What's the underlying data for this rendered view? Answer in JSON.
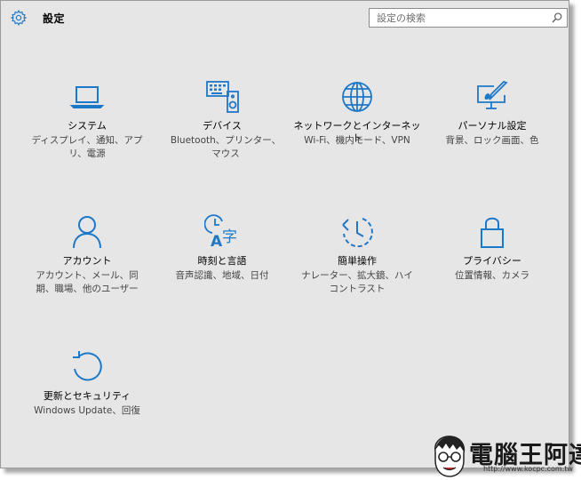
{
  "app": {
    "title": "設定"
  },
  "search": {
    "placeholder": "設定の検索"
  },
  "colors": {
    "accent": "#1e78c8",
    "background": "#e6e6e6"
  },
  "tiles": [
    {
      "id": "system",
      "icon": "laptop-icon",
      "name": "システム",
      "desc": "ディスプレイ、通知、アプリ、電源"
    },
    {
      "id": "devices",
      "icon": "devices-icon",
      "name": "デバイス",
      "desc": "Bluetooth、プリンター、マウス"
    },
    {
      "id": "network",
      "icon": "globe-icon",
      "name": "ネットワークとインターネット",
      "desc": "Wi-Fi、機内モード、VPN"
    },
    {
      "id": "personalization",
      "icon": "paint-icon",
      "name": "パーソナル設定",
      "desc": "背景、ロック画面、色"
    },
    {
      "id": "accounts",
      "icon": "person-icon",
      "name": "アカウント",
      "desc": "アカウント、メール、同期、職場、他のユーザー"
    },
    {
      "id": "time",
      "icon": "time-language-icon",
      "name": "時刻と言語",
      "desc": "音声認識、地域、日付"
    },
    {
      "id": "ease",
      "icon": "ease-of-access-icon",
      "name": "簡単操作",
      "desc": "ナレーター、拡大鏡、ハイコントラスト"
    },
    {
      "id": "privacy",
      "icon": "lock-icon",
      "name": "プライバシー",
      "desc": "位置情報、カメラ"
    },
    {
      "id": "update",
      "icon": "refresh-icon",
      "name": "更新とセキュリティ",
      "desc": "Windows Update、回復"
    }
  ],
  "watermark": {
    "title": "電腦王阿達",
    "url": "http://www.kocpc.com.tw"
  }
}
